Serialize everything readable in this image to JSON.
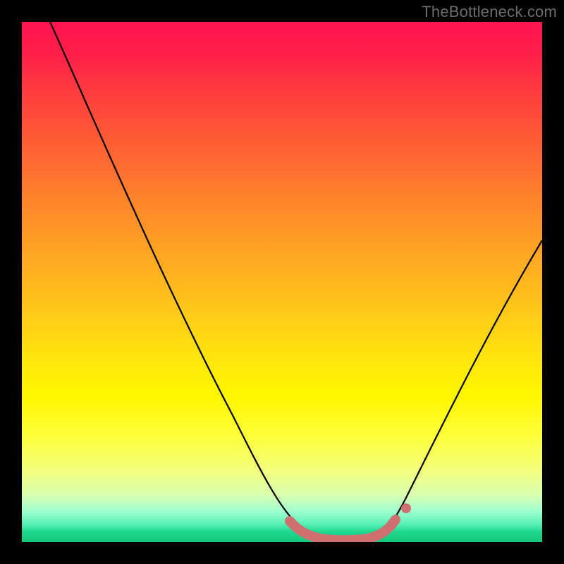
{
  "watermark": "TheBottleneck.com",
  "chart_data": {
    "type": "line",
    "title": "",
    "xlabel": "",
    "ylabel": "",
    "xlim": [
      0,
      100
    ],
    "ylim": [
      0,
      100
    ],
    "background_gradient": {
      "top": "#ff1450",
      "middle": "#ffe000",
      "bottom": "#12c87c"
    },
    "series": [
      {
        "name": "bottleneck-curve",
        "color": "#000000",
        "stroke_width": 2,
        "x": [
          5.4,
          10,
          15,
          20,
          25,
          30,
          35,
          40,
          45,
          50,
          52,
          55,
          58,
          60,
          63,
          66,
          69,
          71,
          72,
          75,
          80,
          85,
          90,
          95,
          100
        ],
        "values": [
          100,
          90.5,
          80.2,
          69.8,
          59.3,
          48.6,
          37.8,
          26.8,
          15.6,
          6.0,
          3.2,
          1.2,
          0.4,
          0.2,
          0.15,
          0.2,
          0.4,
          1.0,
          2.4,
          6.6,
          16.0,
          26.0,
          36.3,
          47.0,
          58.0
        ]
      },
      {
        "name": "pink-overlay-region",
        "color": "#d07070",
        "stroke_width": 12,
        "x": [
          51.5,
          53,
          55,
          58,
          61,
          64,
          67,
          70,
          71,
          71.8
        ],
        "values": [
          3.8,
          2.2,
          1.2,
          0.55,
          0.35,
          0.35,
          0.55,
          1.2,
          2.0,
          3.6
        ]
      },
      {
        "name": "pink-overlay-dot",
        "color": "#d07070",
        "type": "scatter",
        "x": [
          73.8
        ],
        "values": [
          6.2
        ]
      }
    ]
  }
}
